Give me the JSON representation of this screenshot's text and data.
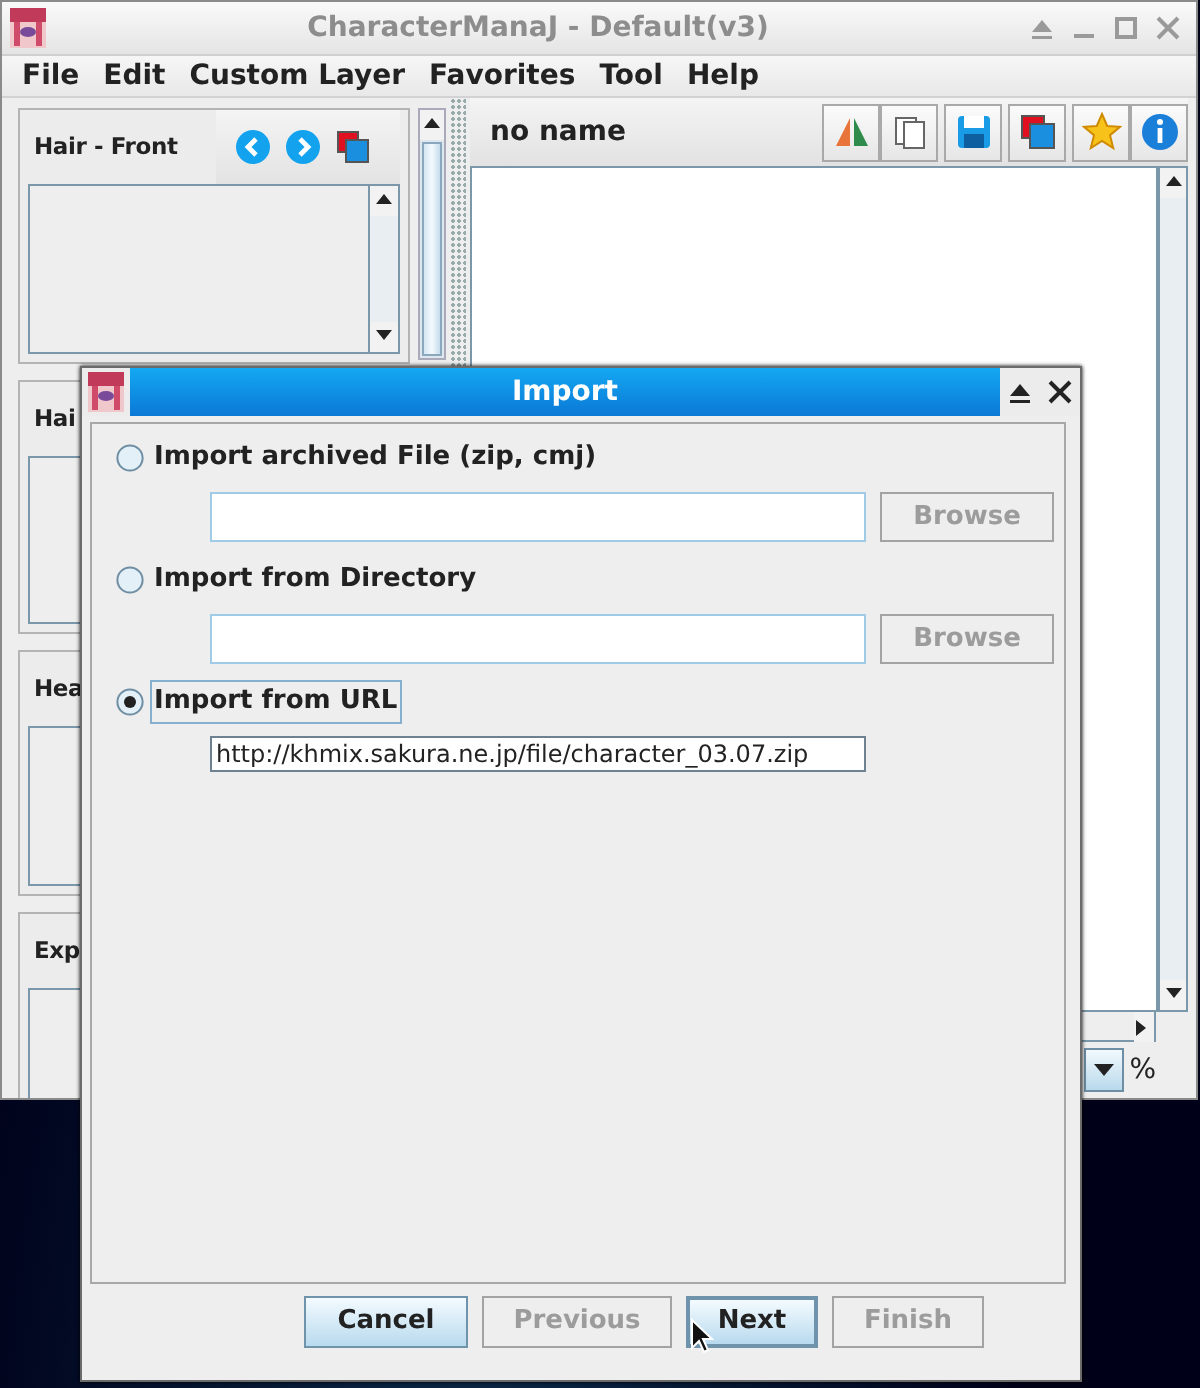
{
  "main_window": {
    "title": "CharacterManaJ - Default(v3)",
    "active": false,
    "menu": [
      {
        "label": "File"
      },
      {
        "label": "Edit"
      },
      {
        "label": "Custom Layer"
      },
      {
        "label": "Favorites"
      },
      {
        "label": "Tool"
      },
      {
        "label": "Help"
      }
    ],
    "parts_panels": [
      {
        "title": "Hair - Front",
        "navigation": true
      },
      {
        "title": "Hai"
      },
      {
        "title": "Hea"
      },
      {
        "title": "Exp"
      }
    ],
    "preview": {
      "title": "no name",
      "zoom_unit": "%"
    }
  },
  "import_dialog": {
    "title": "Import",
    "active": true,
    "options": [
      {
        "label": "Import archived File (zip, cmj)",
        "selected": false,
        "focused": false,
        "browse": {
          "label": "Browse",
          "disabled": true
        }
      },
      {
        "label": "Import from Directory",
        "selected": false,
        "focused": false,
        "browse": {
          "label": "Browse",
          "disabled": true
        }
      },
      {
        "label": "Import from URL",
        "selected": true,
        "focused": true,
        "value": "http://khmix.sakura.ne.jp/file/character_03.07.zip"
      }
    ],
    "buttons": [
      {
        "label": "Cancel",
        "disabled": false,
        "default": false
      },
      {
        "label": "Previous",
        "disabled": true,
        "default": false
      },
      {
        "label": "Next",
        "disabled": false,
        "default": true
      },
      {
        "label": "Finish",
        "disabled": true,
        "default": false
      }
    ]
  }
}
